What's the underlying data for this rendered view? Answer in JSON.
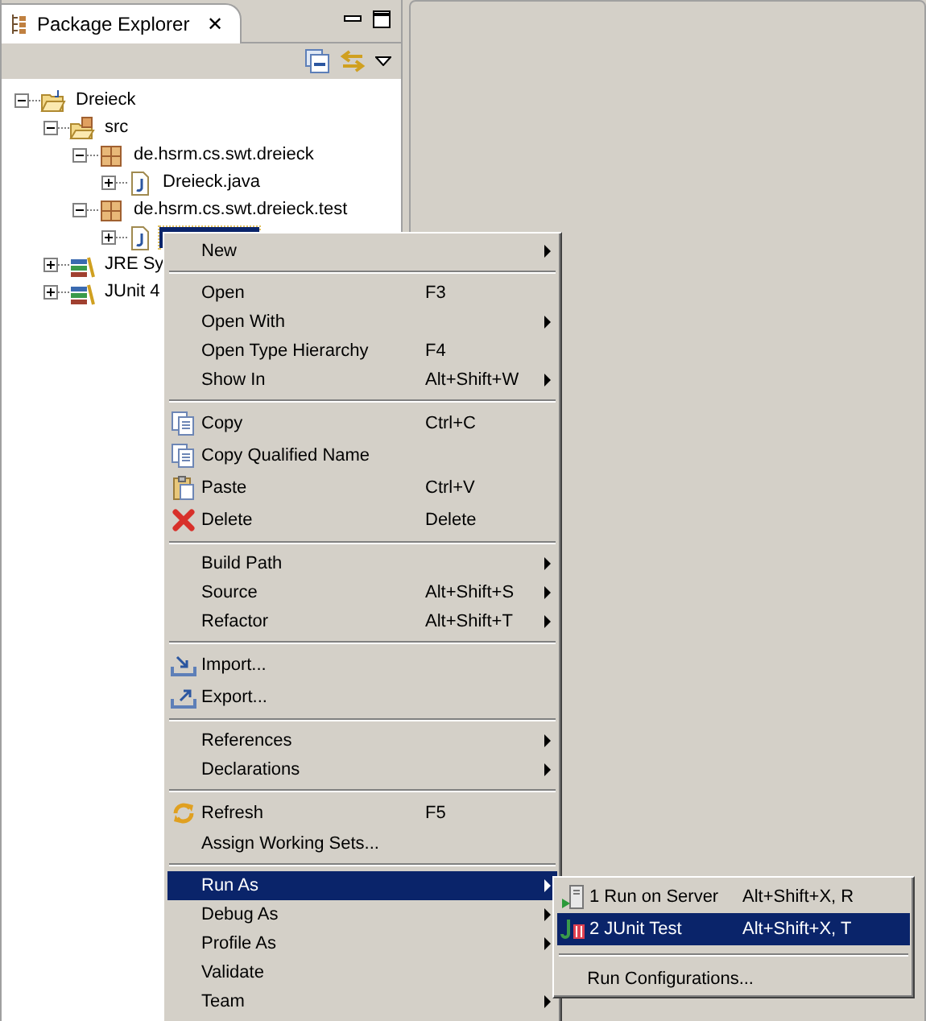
{
  "view": {
    "title": "Package Explorer",
    "close": "✕"
  },
  "tree": [
    {
      "label": "Dreieck",
      "kind": "project",
      "expanded": true,
      "children": [
        {
          "label": "src",
          "kind": "source-folder",
          "expanded": true,
          "children": [
            {
              "label": "de.hsrm.cs.swt.dreieck",
              "kind": "package",
              "expanded": true,
              "children": [
                {
                  "label": "Dreieck.java",
                  "kind": "file",
                  "expanded": false,
                  "selected": false
                }
              ]
            },
            {
              "label": "de.hsrm.cs.swt.dreieck.test",
              "kind": "package",
              "expanded": true,
              "children": [
                {
                  "kind": "file",
                  "expanded": false,
                  "selected": true
                }
              ]
            }
          ]
        },
        {
          "label": "JRE Sy",
          "kind": "library",
          "expanded": false
        },
        {
          "label": "JUnit 4",
          "kind": "library",
          "expanded": false
        }
      ]
    }
  ],
  "context_menu": [
    {
      "kind": "item",
      "label": "New",
      "submenu": true,
      "selected": false
    },
    {
      "kind": "separator"
    },
    {
      "kind": "item",
      "label": "Open",
      "shortcut": "F3",
      "submenu": false,
      "selected": false
    },
    {
      "kind": "item",
      "label": "Open With",
      "submenu": true,
      "selected": false
    },
    {
      "kind": "item",
      "label": "Open Type Hierarchy",
      "shortcut": "F4",
      "submenu": false,
      "selected": false
    },
    {
      "kind": "item",
      "label": "Show In",
      "shortcut": "Alt+Shift+W",
      "submenu": true,
      "selected": false
    },
    {
      "kind": "separator"
    },
    {
      "kind": "item",
      "label": "Copy",
      "shortcut": "Ctrl+C",
      "submenu": false,
      "selected": false
    },
    {
      "kind": "item",
      "label": "Copy Qualified Name",
      "submenu": false,
      "selected": false
    },
    {
      "kind": "item",
      "label": "Paste",
      "shortcut": "Ctrl+V",
      "submenu": false,
      "selected": false
    },
    {
      "kind": "item",
      "label": "Delete",
      "shortcut": "Delete",
      "submenu": false,
      "selected": false
    },
    {
      "kind": "separator"
    },
    {
      "kind": "item",
      "label": "Build Path",
      "submenu": true,
      "selected": false
    },
    {
      "kind": "item",
      "label": "Source",
      "shortcut": "Alt+Shift+S",
      "submenu": true,
      "selected": false
    },
    {
      "kind": "item",
      "label": "Refactor",
      "shortcut": "Alt+Shift+T",
      "submenu": true,
      "selected": false
    },
    {
      "kind": "separator"
    },
    {
      "kind": "item",
      "label": "Import...",
      "submenu": false,
      "selected": false
    },
    {
      "kind": "item",
      "label": "Export...",
      "submenu": false,
      "selected": false
    },
    {
      "kind": "separator"
    },
    {
      "kind": "item",
      "label": "References",
      "submenu": true,
      "selected": false
    },
    {
      "kind": "item",
      "label": "Declarations",
      "submenu": true,
      "selected": false
    },
    {
      "kind": "separator"
    },
    {
      "kind": "item",
      "label": "Refresh",
      "shortcut": "F5",
      "submenu": false,
      "selected": false
    },
    {
      "kind": "item",
      "label": "Assign Working Sets...",
      "submenu": false,
      "selected": false
    },
    {
      "kind": "separator"
    },
    {
      "kind": "item",
      "label": "Run As",
      "submenu": true,
      "selected": true
    },
    {
      "kind": "item",
      "label": "Debug As",
      "submenu": true,
      "selected": false
    },
    {
      "kind": "item",
      "label": "Profile As",
      "submenu": true,
      "selected": false
    },
    {
      "kind": "item",
      "label": "Validate",
      "submenu": false,
      "selected": false
    },
    {
      "kind": "item",
      "label": "Team",
      "submenu": true,
      "selected": false
    }
  ],
  "submenu": [
    {
      "kind": "item",
      "label": "1 Run on Server",
      "shortcut": "Alt+Shift+X, R",
      "selected": false
    },
    {
      "kind": "item",
      "label": "2 JUnit Test",
      "shortcut": "Alt+Shift+X, T",
      "selected": true
    },
    {
      "kind": "separator"
    },
    {
      "kind": "item",
      "label": "Run Configurations...",
      "selected": false
    }
  ]
}
